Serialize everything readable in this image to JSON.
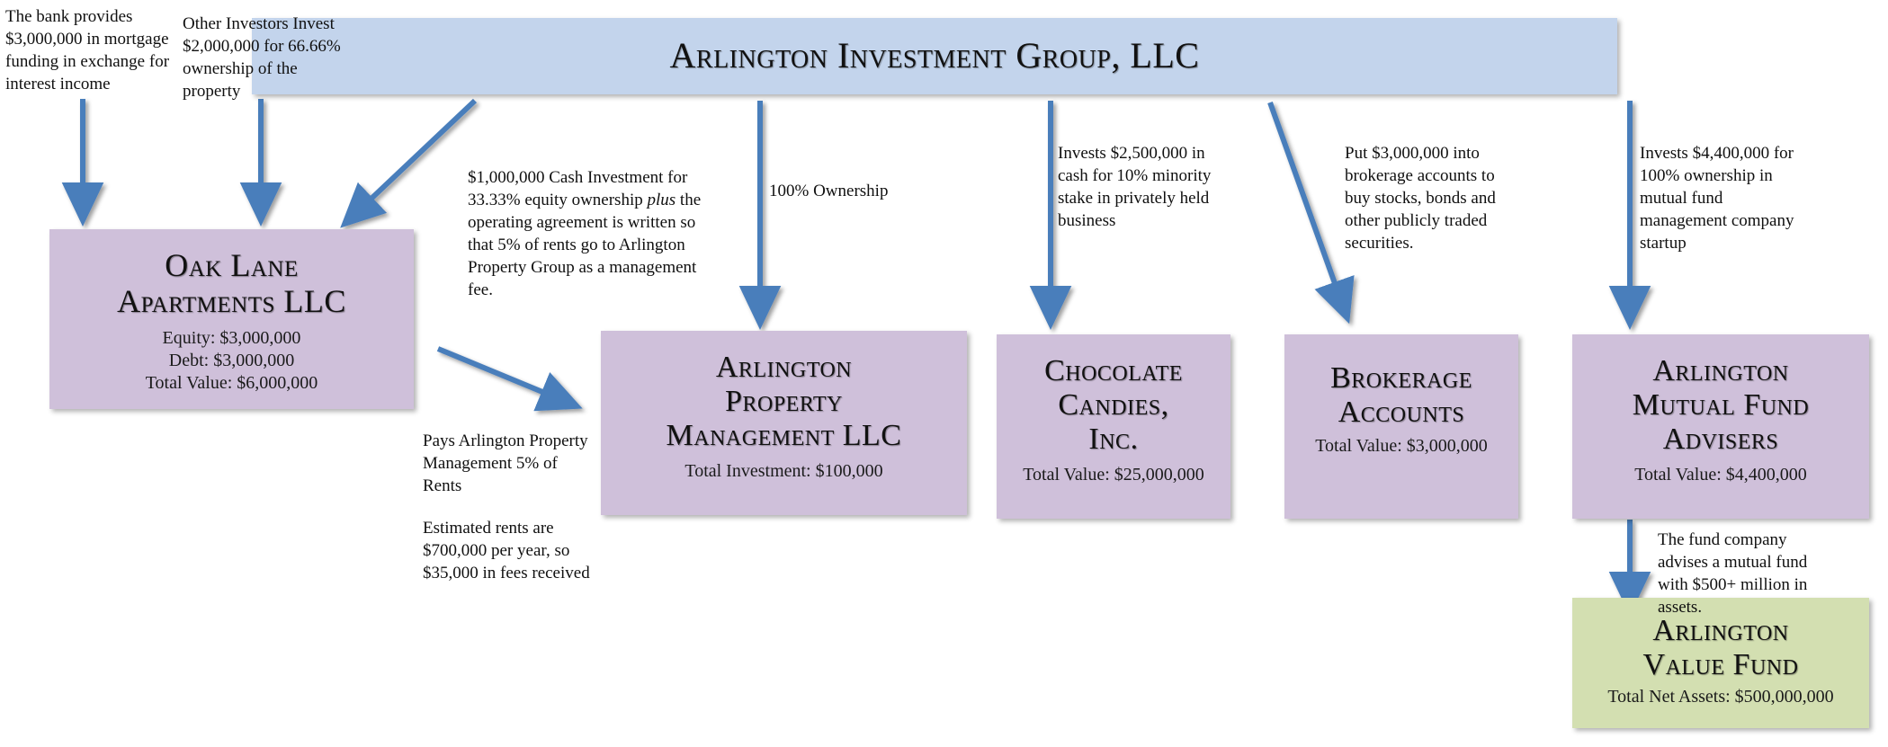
{
  "diagram": {
    "title": "Arlington Investment Group, LLC",
    "header": {
      "label": "Arlington Investment Group, LLC"
    },
    "entities": [
      {
        "id": "oak-lane-apartments",
        "name": "Oak Lane\nApartments LLC",
        "details": "Equity: $3,000,000\nDebt: $3,000,000\nTotal Value: $6,000,000",
        "color": "#cfc0da"
      },
      {
        "id": "arlington-property-management",
        "name": "Arlington\nProperty\nManagement LLC",
        "details": "Total Investment: $100,000",
        "color": "#cfc0da"
      },
      {
        "id": "chocolate-candies",
        "name": "Chocolate\nCandies,\nInc.",
        "details": "Total Value: $25,000,000",
        "color": "#cfc0da"
      },
      {
        "id": "brokerage-accounts",
        "name": "Brokerage\nAccounts",
        "details": "Total Value: $3,000,000",
        "color": "#cfc0da"
      },
      {
        "id": "arlington-mutual-fund-advisers",
        "name": "Arlington\nMutual Fund\nAdvisers",
        "details": "Total Value: $4,400,000",
        "color": "#cfc0da"
      },
      {
        "id": "arlington-value-fund",
        "name": "Arlington\nValue Fund",
        "details": "Total Net Assets: $500,000,000",
        "color": "#d3dfb1"
      }
    ],
    "annotations": {
      "bank_mortgage": "The bank provides $3,000,000 in mortgage funding in exchange for interest income",
      "other_investors": "Other Investors Invest $2,000,000 for 66.66% ownership of the property",
      "cash_investment_pre": "$1,000,000 Cash Investment for 33.33% equity ownership ",
      "cash_investment_em": "plus",
      "cash_investment_post": " the operating agreement is written so that 5% of rents go to Arlington Property Group as a management fee.",
      "pays_management_fee": "Pays Arlington Property Management 5% of Rents",
      "estimated_rents": "Estimated rents are $700,000 per year, so $35,000 in fees received",
      "hundred_percent_ownership": "100% Ownership",
      "chocolate_candies_invest": "Invests $2,500,000 in cash for 10% minority stake in privately held business",
      "brokerage_invest": "Put $3,000,000 into brokerage accounts to buy stocks, bonds and other publicly traded securities.",
      "mutual_fund_invest": "Invests $4,400,000 for 100% ownership in mutual fund management company startup",
      "fund_company_advises": "The fund company advises a mutual fund with $500+ million in assets."
    },
    "colors": {
      "header_blue": "#c3d4ec",
      "entity_purple": "#cfc0da",
      "fund_green": "#d3dfb1",
      "arrow_blue": "#4a7ebb"
    }
  }
}
